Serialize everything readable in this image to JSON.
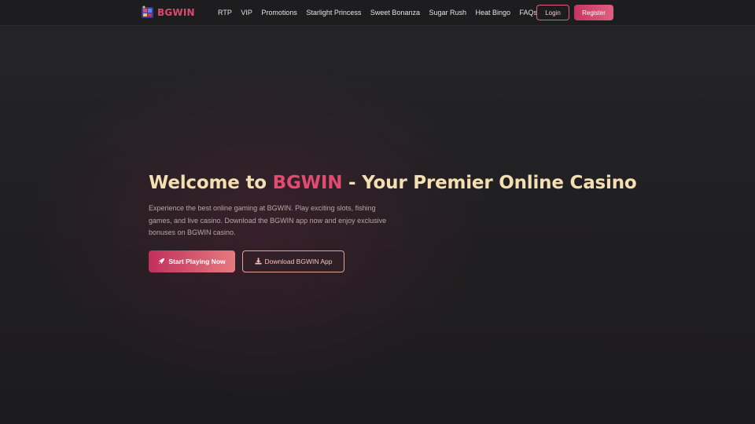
{
  "header": {
    "logo_text": "BGWIN",
    "nav": [
      {
        "label": "RTP"
      },
      {
        "label": "VIP"
      },
      {
        "label": "Promotions"
      },
      {
        "label": "Starlight Princess"
      },
      {
        "label": "Sweet Bonanza"
      },
      {
        "label": "Sugar Rush"
      },
      {
        "label": "Heat Bingo"
      },
      {
        "label": "FAQs"
      }
    ],
    "login_label": "Login",
    "register_label": "Register"
  },
  "hero": {
    "title_prefix": "Welcome to ",
    "title_brand": "BGWIN",
    "title_suffix": " - Your Premier Online Casino",
    "description": "Experience the best online gaming at BGWIN. Play exciting slots, fishing games, and live casino. Download the BGWIN app now and enjoy exclusive bonuses on BGWIN casino.",
    "primary_cta": "Start Playing Now",
    "primary_cta_icon": "rocket-icon",
    "secondary_cta": "Download BGWIN App",
    "secondary_cta_icon": "download-icon"
  },
  "colors": {
    "background": "#1f1f21",
    "brand_pink": "#e34a70",
    "title_cream": "#f3dfb2",
    "button_gradient_start": "#c2305c",
    "button_gradient_end": "#e57a7f"
  }
}
